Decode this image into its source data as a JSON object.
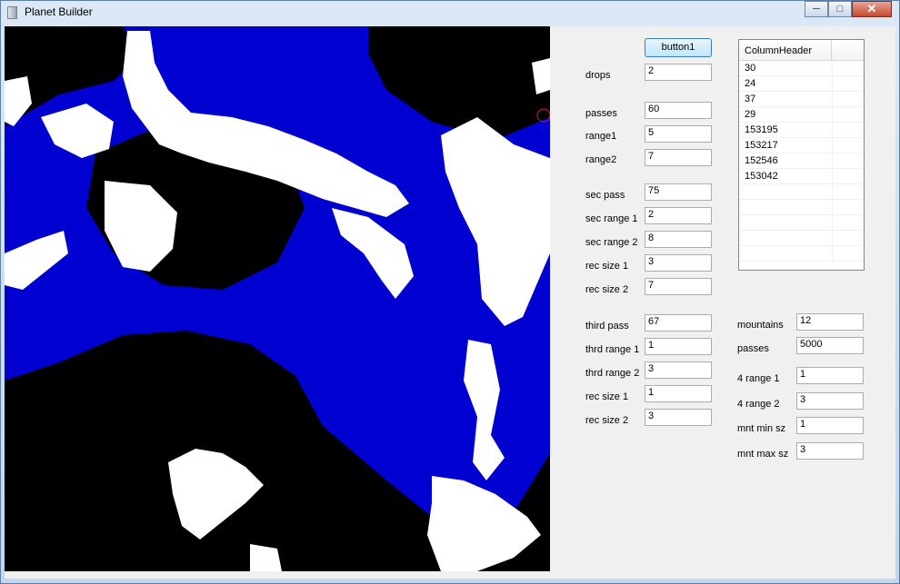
{
  "window": {
    "title": "Planet Builder"
  },
  "button1": "button1",
  "fields": {
    "drops": {
      "label": "drops",
      "value": "2"
    },
    "passes": {
      "label": "passes",
      "value": "60"
    },
    "range1": {
      "label": "range1",
      "value": "5"
    },
    "range2": {
      "label": "range2",
      "value": "7"
    },
    "sec_pass": {
      "label": "sec pass",
      "value": "75"
    },
    "sec_range1": {
      "label": "sec range 1",
      "value": "2"
    },
    "sec_range2": {
      "label": "sec range 2",
      "value": "8"
    },
    "rec_size1": {
      "label": "rec size 1",
      "value": "3"
    },
    "rec_size2": {
      "label": "rec size 2",
      "value": "7"
    },
    "third_pass": {
      "label": "third pass",
      "value": "67"
    },
    "thrd_range1": {
      "label": "thrd range 1",
      "value": "1"
    },
    "thrd_range2": {
      "label": "thrd range 2",
      "value": "3"
    },
    "rec_size1b": {
      "label": "rec size 1",
      "value": "1"
    },
    "rec_size2b": {
      "label": "rec size 2",
      "value": "3"
    },
    "mountains": {
      "label": "mountains",
      "value": "12"
    },
    "m_passes": {
      "label": "passes",
      "value": "5000"
    },
    "range4_1": {
      "label": "4 range 1",
      "value": "1"
    },
    "range4_2": {
      "label": "4 range 2",
      "value": "3"
    },
    "mnt_min": {
      "label": "mnt min sz",
      "value": "1"
    },
    "mnt_max": {
      "label": "mnt max sz",
      "value": "3"
    }
  },
  "listview": {
    "header": "ColumnHeader",
    "rows": [
      "30",
      "24",
      "37",
      "29",
      "153195",
      "153217",
      "152546",
      "153042",
      "",
      "",
      "",
      "",
      ""
    ]
  },
  "colors": {
    "water": "#0000d0",
    "land": "#000000",
    "ice": "#ffffff"
  }
}
